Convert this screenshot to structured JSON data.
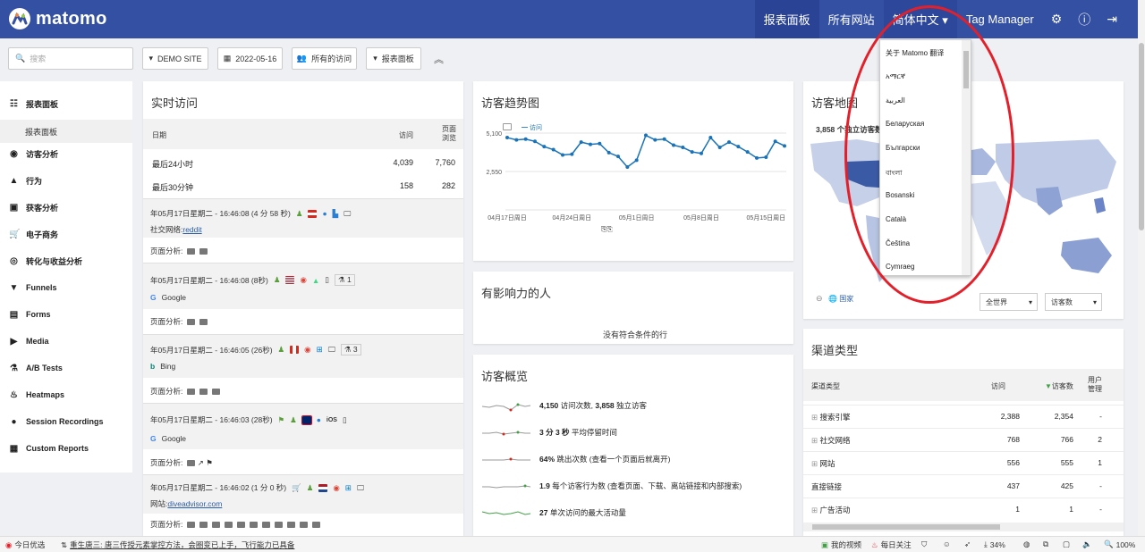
{
  "topbar": {
    "brand": "matomo",
    "nav": [
      "报表面板",
      "所有网站",
      "简体中文 ▾",
      "Tag Manager"
    ]
  },
  "toolbar": {
    "search_placeholder": "搜索",
    "site": "DEMO SITE",
    "date": "2022-05-16",
    "segment": "所有的访问",
    "dashboard": "报表面板"
  },
  "sidebar": {
    "items": [
      "报表面板",
      "访客分析",
      "行为",
      "获客分析",
      "电子商务",
      "转化与收益分析",
      "Funnels",
      "Forms",
      "Media",
      "A/B Tests",
      "Heatmaps",
      "Session Recordings",
      "Custom Reports"
    ],
    "sub_item": "报表面板"
  },
  "realtime": {
    "title": "实时访问",
    "col_date": "日期",
    "col_visits": "访问",
    "col_views": "页面\n浏览",
    "rows": [
      {
        "label": "最后24小时",
        "visits": "4,039",
        "views": "7,760"
      },
      {
        "label": "最后30分钟",
        "visits": "158",
        "views": "282"
      }
    ],
    "page_label": "页面分析:",
    "visits": [
      {
        "time": "年05月17日星期二 - 16:46:08 (4 分 58 秒)",
        "source_prefix": "社交网络: ",
        "source": "reddit",
        "source_link": true
      },
      {
        "time": "年05月17日星期二 - 16:46:08 (8秒)",
        "source": "Google",
        "action_count": "1"
      },
      {
        "time": "年05月17日星期二 - 16:46:05 (26秒)",
        "source": "Bing",
        "action_count": "3"
      },
      {
        "time": "年05月17日星期二 - 16:46:03 (28秒)",
        "source": "Google",
        "os": "iOS"
      },
      {
        "time": "年05月17日星期二 - 16:46:02 (1 分 0 秒)",
        "source_prefix": "网站: ",
        "source": "diveadvisor.com",
        "source_link": true
      }
    ]
  },
  "trend": {
    "title": "访客趋势图",
    "legend": "访问"
  },
  "chart_data": {
    "type": "line",
    "x": [
      "04月17日周日",
      "04月24日周日",
      "05月1日周日",
      "05月8日周日",
      "05月15日周日"
    ],
    "ylim": [
      0,
      5100
    ],
    "yticks": [
      "5,100",
      "2,550",
      "0"
    ],
    "series": [
      {
        "name": "访问",
        "values": [
          4800,
          4650,
          4700,
          4550,
          4200,
          4000,
          3650,
          3700,
          4500,
          4350,
          4400,
          3800,
          3550,
          2850,
          3300,
          4950,
          4650,
          4700,
          4300,
          4150,
          3850,
          3750,
          4800,
          4150,
          4500,
          4200,
          3850,
          3450,
          3500,
          4550,
          4250
        ]
      }
    ]
  },
  "influencers": {
    "title": "有影响力的人",
    "empty": "没有符合条件的行"
  },
  "overview": {
    "title": "访客概览",
    "rows": [
      {
        "bold": "4,150",
        "text": " 访问次数, ",
        "bold2": "3,858",
        "text2": " 独立访客"
      },
      {
        "bold": "3 分 3 秒",
        "text": " 平均停留时间",
        "bold2": "",
        "text2": ""
      },
      {
        "bold": "64%",
        "text": " 跳出次数 (查看一个页面后就离开)",
        "bold2": "",
        "text2": ""
      },
      {
        "bold": "1.9",
        "text": " 每个访客行为数 (查看页面、下载、离站链接和内部搜索)",
        "bold2": "",
        "text2": ""
      },
      {
        "bold": "27",
        "text": " 单次访问的最大活动量",
        "bold2": "",
        "text2": ""
      }
    ]
  },
  "map": {
    "title": "访客地图",
    "summary": "3,858 个独立访客数",
    "country_label": "国家",
    "region_select": "全世界",
    "metric_select": "访客数"
  },
  "channel": {
    "title": "渠道类型",
    "col_type": "渠道类型",
    "col_visits": "访问",
    "col_visitors": "访客数",
    "col_user": "用户\n管理",
    "rows": [
      {
        "name": "搜索引擎",
        "visits": "2,388",
        "visitors": "2,354",
        "user": "-",
        "expand": true
      },
      {
        "name": "社交网络",
        "visits": "768",
        "visitors": "766",
        "user": "2",
        "expand": true
      },
      {
        "name": "网站",
        "visits": "556",
        "visitors": "555",
        "user": "1",
        "expand": true
      },
      {
        "name": "直接链接",
        "visits": "437",
        "visitors": "425",
        "user": "-",
        "expand": false
      },
      {
        "name": "广告活动",
        "visits": "1",
        "visitors": "1",
        "user": "-",
        "expand": true
      }
    ]
  },
  "language_dropdown": {
    "items": [
      "关于 Matomo 翻译",
      "አማርኛ",
      "العربية",
      "Беларуская",
      "Български",
      "বাংলা",
      "Bosanski",
      "Català",
      "Čeština",
      "Cymraeg"
    ]
  },
  "statusbar": {
    "left1": "今日优选",
    "left2": "重生唐三: 唐三传授元素掌控方法，会圈变已上手，飞行能力已具备",
    "video": "我的视频",
    "follow": "每日关注",
    "zoom_pct": "34%",
    "page_zoom": "100%"
  }
}
